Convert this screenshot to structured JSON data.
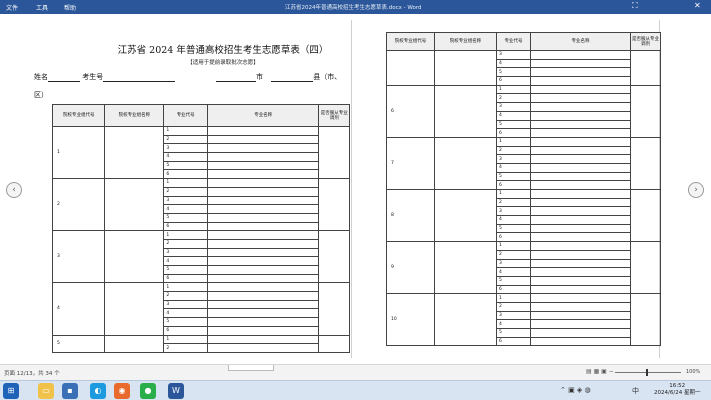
{
  "window": {
    "menu": [
      "文件",
      "工具",
      "帮助"
    ],
    "title": "江苏省2024年普通高校招生考生志愿草表.docx - Word",
    "btn_fullscreen": "⛶",
    "btn_close": "✕"
  },
  "document": {
    "title": "江苏省 2024 年普通高校招生考生志愿草表（四）",
    "subtitle": "【适用于提前录取批次志愿】",
    "name_label": "姓名",
    "exam_label": "考生号",
    "city_label": "市",
    "county_label": "县（市、",
    "district_label": "区）"
  },
  "left_table": {
    "headers": [
      "院校专业组代号",
      "院校专业组名称",
      "专业代号",
      "专业名称",
      "是否服从专业调剂"
    ],
    "groups": [
      {
        "label": "1",
        "rows": [
          "1",
          "2",
          "3",
          "4",
          "5",
          "6"
        ]
      },
      {
        "label": "2",
        "rows": [
          "1",
          "2",
          "3",
          "4",
          "5",
          "6"
        ]
      },
      {
        "label": "3",
        "rows": [
          "1",
          "2",
          "3",
          "4",
          "5",
          "6"
        ]
      },
      {
        "label": "4",
        "rows": [
          "1",
          "2",
          "3",
          "4",
          "5",
          "6"
        ]
      },
      {
        "label": "5",
        "rows": [
          "1",
          "2"
        ]
      }
    ]
  },
  "right_table": {
    "headers": [
      "院校专业组代号",
      "院校专业组名称",
      "专业代号",
      "专业名称",
      "是否服从专业调剂"
    ],
    "groups": [
      {
        "label": "",
        "rows": [
          "3",
          "4",
          "5",
          "6"
        ]
      },
      {
        "label": "6",
        "rows": [
          "1",
          "2",
          "3",
          "4",
          "5",
          "6"
        ]
      },
      {
        "label": "7",
        "rows": [
          "1",
          "2",
          "3",
          "4",
          "5",
          "6"
        ]
      },
      {
        "label": "8",
        "rows": [
          "1",
          "2",
          "3",
          "4",
          "5",
          "6"
        ]
      },
      {
        "label": "9",
        "rows": [
          "1",
          "2",
          "3",
          "4",
          "5",
          "6"
        ]
      },
      {
        "label": "10",
        "rows": [
          "1",
          "2",
          "3",
          "4",
          "5",
          "6"
        ]
      }
    ]
  },
  "statusbar": {
    "page_info": "页面 12/13，共 34 个",
    "zoom": "100%"
  },
  "taskbar": {
    "time": "16:52",
    "date": "2024/6/24 星期一",
    "lang": "中",
    "word_label": "W"
  },
  "icons": {
    "prev_page": "chevron-left-icon",
    "next_page": "chevron-right-icon"
  }
}
